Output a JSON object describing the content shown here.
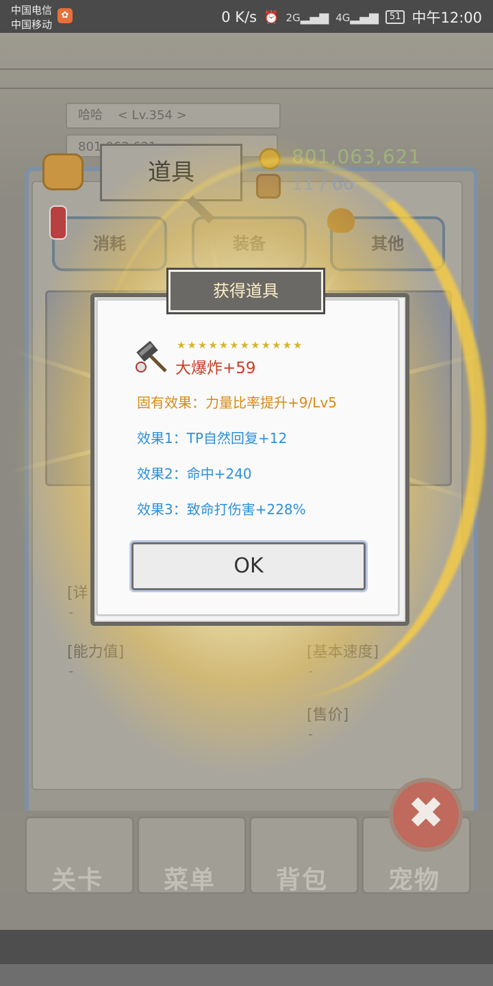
{
  "status_bar": {
    "carrier_1": "中国电信",
    "carrier_2": "中国移动",
    "net_speed": "0 K/s",
    "signal_1": "2G",
    "signal_2": "4G",
    "battery": "51",
    "time": "中午12:00"
  },
  "player": {
    "name": "哈哈",
    "level": "< Lv.354 >",
    "gold_partial": "801,063,621"
  },
  "inventory": {
    "title": "道具",
    "money": "801,063,621",
    "slots": "11 / 60",
    "tabs": [
      "消耗",
      "装备",
      "其他"
    ],
    "stats": {
      "detail_label": "[详",
      "detail_value": "-",
      "ability_label": "[能力值]",
      "ability_value": "-",
      "speed_label": "[基本速度]",
      "speed_value": "-",
      "price_label": "[售价]",
      "price_value": "-"
    }
  },
  "nav": [
    "关卡",
    "菜单",
    "背包",
    "宠物"
  ],
  "dialog": {
    "title": "获得道具",
    "stars": "★★★★★★★★★★★★",
    "item_name": "大爆炸+59",
    "inherent": "固有效果：力量比率提升+9/Lv5",
    "effect_1": "效果1：TP自然回复+12",
    "effect_2": "效果2：命中+240",
    "effect_3": "效果3：致命打伤害+228%",
    "ok": "OK"
  },
  "colors": {
    "item_name": "#c83c26",
    "inherent": "#d68a14",
    "effect": "#2e8fd8"
  }
}
